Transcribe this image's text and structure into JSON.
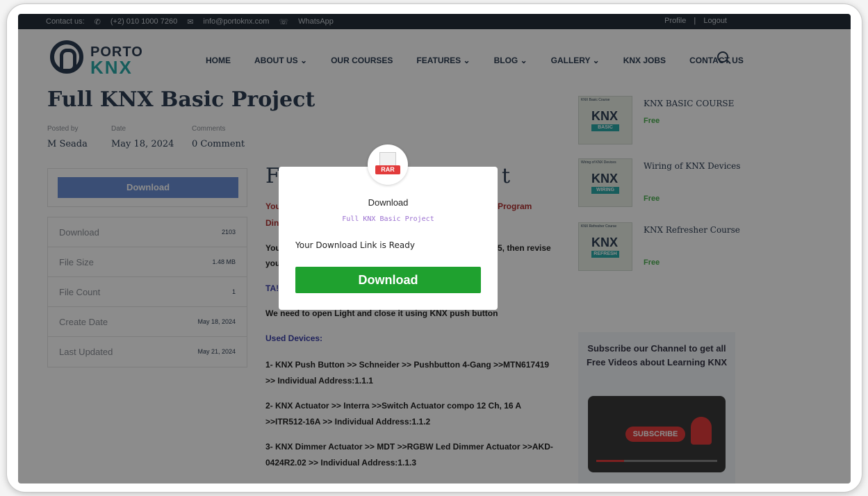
{
  "topbar": {
    "contact_label": "Contact us:",
    "phone": "(+2) 010 1000 7260",
    "email": "info@portoknx.com",
    "whatsapp": "WhatsApp",
    "profile": "Profile",
    "separator": "|",
    "logout": "Logout"
  },
  "logo": {
    "top": "PORTO",
    "bottom": "KNX"
  },
  "menu": {
    "items": [
      "HOME",
      "ABOUT US ⌄",
      "OUR COURSES",
      "FEATURES ⌄",
      "BLOG ⌄",
      "GALLERY ⌄",
      "KNX JOBS",
      "CONTACT US"
    ]
  },
  "post": {
    "title": "Full KNX Basic Project",
    "posted_by_label": "Posted by",
    "posted_by": "M Seada",
    "date_label": "Date",
    "date": "May 18, 2024",
    "comments_label": "Comments",
    "comments": "0 Comment"
  },
  "download_box": {
    "button": "Download"
  },
  "stats": [
    {
      "k": "Download",
      "v": "2103"
    },
    {
      "k": "File Size",
      "v": "1.48 MB"
    },
    {
      "k": "File Count",
      "v": "1"
    },
    {
      "k": "Create Date",
      "v": "May 18, 2024"
    },
    {
      "k": "Last Updated",
      "v": "May 21, 2024"
    }
  ],
  "content": {
    "heading_start": "F",
    "heading_end": "t",
    "line1_start": "You",
    "line1_end": "Program",
    "line2_start": "Din",
    "line3_start": "You",
    "line3_end": "5, then revise",
    "line4_start": "you",
    "task_start": "TA!",
    "p1": "We need to open Light and close it using KNX push button",
    "used_devices": "Used Devices:",
    "d1a": "1- KNX Push Button >> Schneider >> Pushbutton 4-Gang >>MTN617419",
    "d1b": ">> Individual Address:1.1.1",
    "d2a": "2- KNX Actuator >> Interra >>Switch Actuator compo 12 Ch, 16 A",
    "d2b": ">>ITR512-16A >> Individual Address:1.1.2",
    "d3a": "3- KNX Dimmer Actuator >> MDT >>RGBW Led Dimmer Actuator >>AKD-",
    "d3b": "0424R2.02 >> Individual Address:1.1.3"
  },
  "sidebar": {
    "courses": [
      {
        "title": "KNX BASIC COURSE",
        "price": "Free",
        "thumb_tag": "KNX Basic Course",
        "thumb_band": "BASIC"
      },
      {
        "title": "Wiring of KNX Devices",
        "price": "Free",
        "thumb_tag": "Wiring of KNX Devices",
        "thumb_band": "WIRING"
      },
      {
        "title": "KNX Refresher Course",
        "price": "Free",
        "thumb_tag": "KNX Refresher Course",
        "thumb_band": "REFRESH"
      }
    ],
    "thumb_logo": "KNX",
    "promo_text": "Subscribe our Channel to get all Free Videos about Learning KNX",
    "promo_button": "SUBSCRIBE"
  },
  "modal": {
    "badge": "RAR",
    "title": "Download",
    "subtitle": "Full KNX Basic Project",
    "ready": "Your Download Link is Ready",
    "button": "Download"
  },
  "colors": {
    "accent_green": "#1fa12f",
    "nav_dark": "#262f3a",
    "brand_teal": "#2ba9a8",
    "free_green": "#4caf50"
  }
}
